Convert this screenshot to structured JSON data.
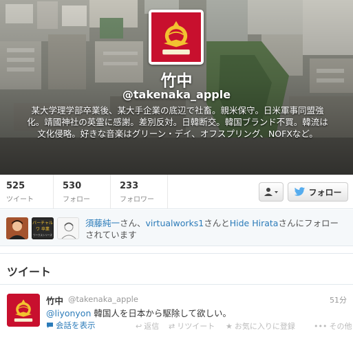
{
  "profile": {
    "name": "竹中",
    "screen_name": "@takenaka_apple",
    "bio": "某大学理学部卒業後、某大手企業の底辺で社畜。親米保守。日米軍事同盟強化。靖國神社の英霊に感謝。差別反対。日韓断交。韓国ブランド不買。韓流は文化侵略。好きな音楽はグリーン・デイ、オフスプリング、NOFXなど。"
  },
  "stats": [
    {
      "count": "525",
      "label": "ツイート"
    },
    {
      "count": "530",
      "label": "フォロー"
    },
    {
      "count": "233",
      "label": "フォロワー"
    }
  ],
  "buttons": {
    "follow_label": "フォロー"
  },
  "followed_by": {
    "user1": "須藤純一",
    "sep1": "さん、",
    "user2": "virtualworks1",
    "sep2": "さんと",
    "user3": "Hide Hirata",
    "tail": "さんにフォローされています",
    "thumb_text": [
      "バーチャル",
      "ワ 卒業",
      "ワークスシリーズ"
    ]
  },
  "tweets_section": {
    "title": "ツイート"
  },
  "tweet": {
    "name": "竹中",
    "handle": "@takenaka_apple",
    "time": "51分",
    "mention": "@liyonyon",
    "text": " 韓国人を日本から駆除して欲しい。",
    "expand_label": "会話を表示",
    "actions": {
      "reply": "返信",
      "retweet": "リツイート",
      "favorite": "お気に入りに登録",
      "more": "その他"
    }
  },
  "colors": {
    "link": "#2b7bb9",
    "twitter_blue": "#55acee",
    "avatar_red": "#c8102e",
    "emblem_gold": "#f2c230"
  }
}
